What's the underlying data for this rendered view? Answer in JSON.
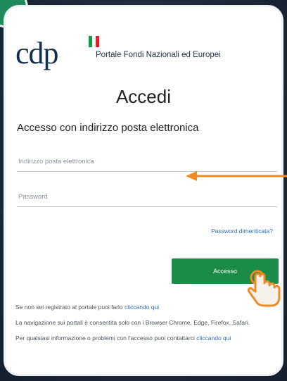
{
  "colors": {
    "accent": "#1b8c48",
    "link": "#2a6fb0",
    "annotation": "#f08a24",
    "background": "#1c2a3a"
  },
  "brand": {
    "logo_text": "cdp",
    "portal_title": "Portale Fondi Nazionali ed Europei"
  },
  "page": {
    "title": "Accedi",
    "subtitle": "Accesso con indirizzo posta elettronica"
  },
  "form": {
    "email_placeholder": "Indirizzo posta elettronica",
    "password_placeholder": "Password",
    "forgot_link": "Password dimenticata?",
    "submit_label": "Accesso"
  },
  "footer": {
    "register_text": "Se non sei registrato al portale puoi farlo ",
    "register_link": "cliccando qui",
    "browser_note": "La navigazione sui portali è consentita solo con i Browser Chrome, Edge, Firefox, Safari.",
    "help_text": "Per qualsiasi informazione o problemi con l'accesso puoi contattarci ",
    "help_link": "cliccando qui"
  },
  "icons": {
    "annotation_arrow": "arrow-left-icon",
    "pointer": "hand-pointer-icon"
  }
}
